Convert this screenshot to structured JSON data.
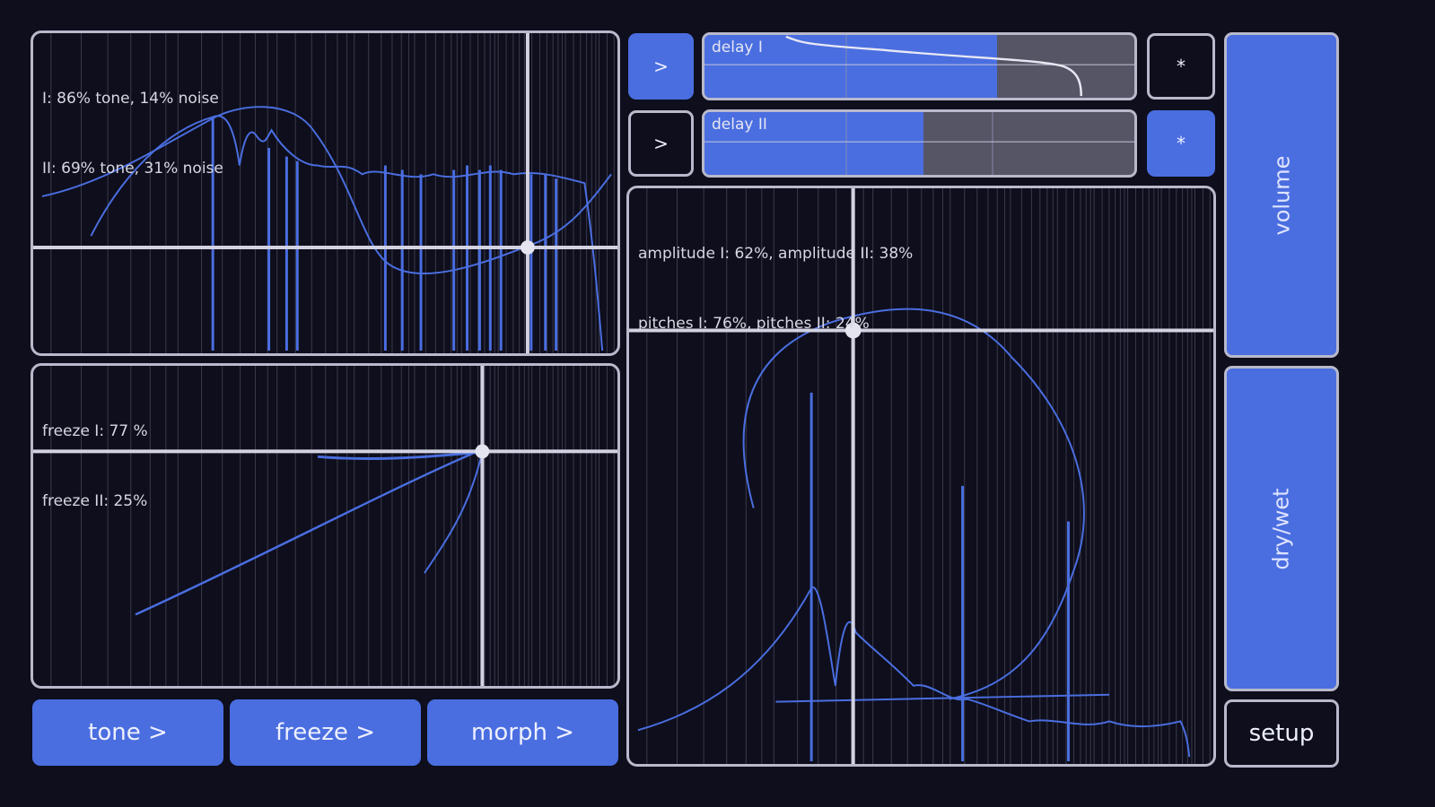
{
  "colors": {
    "background": "#0e0e1c",
    "accent": "#4a6ee0",
    "border": "#b9b9cc",
    "track": "#555566",
    "grid": "#3a3a4c"
  },
  "tone_panel": {
    "line1": "I: 86% tone, 14% noise",
    "line2": "II: 69% tone, 31% noise"
  },
  "freeze_panel": {
    "line1": "freeze I: 77 %",
    "line2": "freeze II: 25%"
  },
  "morph_panel": {
    "line1": "amplitude I: 62%, amplitude II: 38%",
    "line2": "pitches I: 76%, pitches II: 24%"
  },
  "buttons": {
    "tone": "tone >",
    "freeze": "freeze >",
    "morph": "morph >",
    "setup": "setup",
    "play1": ">",
    "play2": ">",
    "star1": "*",
    "star2": "*",
    "volume": "volume",
    "drywet": "dry/wet"
  },
  "delays": {
    "delay1": {
      "label": "delay I",
      "level": 0.68
    },
    "delay2": {
      "label": "delay II",
      "level": 0.51
    }
  }
}
